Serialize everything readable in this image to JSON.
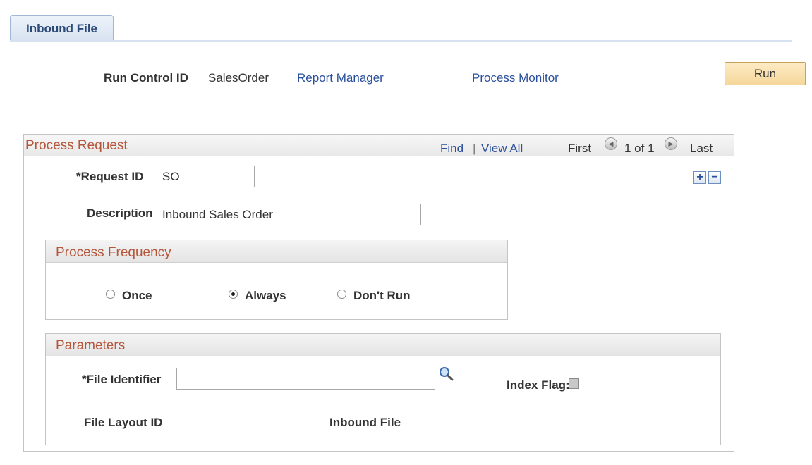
{
  "tab": {
    "label": "Inbound File"
  },
  "header": {
    "run_control_label": "Run Control ID",
    "run_control_value": "SalesOrder",
    "report_manager_link": "Report Manager",
    "process_monitor_link": "Process Monitor",
    "run_button": "Run"
  },
  "process_request": {
    "title": "Process Request",
    "find_link": "Find",
    "separator": "|",
    "view_all_link": "View All",
    "first_label": "First",
    "position": "1 of 1",
    "last_label": "Last",
    "request_id_label": "*Request ID",
    "request_id_value": "SO",
    "description_label": "Description",
    "description_value": "Inbound Sales Order"
  },
  "frequency": {
    "title": "Process Frequency",
    "options": [
      "Once",
      "Always",
      "Don't Run"
    ],
    "selected": "Always"
  },
  "parameters": {
    "title": "Parameters",
    "file_identifier_label": "*File Identifier",
    "file_identifier_value": "",
    "index_flag_label": "Index Flag:",
    "index_flag_checked": false,
    "file_layout_label": "File Layout ID",
    "inbound_file_label": "Inbound File"
  },
  "icons": {
    "prev": "arrow-left-icon",
    "next": "arrow-right-icon",
    "add": "plus-icon",
    "remove": "minus-icon",
    "lookup": "magnifier-icon"
  },
  "colors": {
    "section_title": "#b5553a",
    "link": "#2a4f9b",
    "run_button": "#f5d79b"
  }
}
